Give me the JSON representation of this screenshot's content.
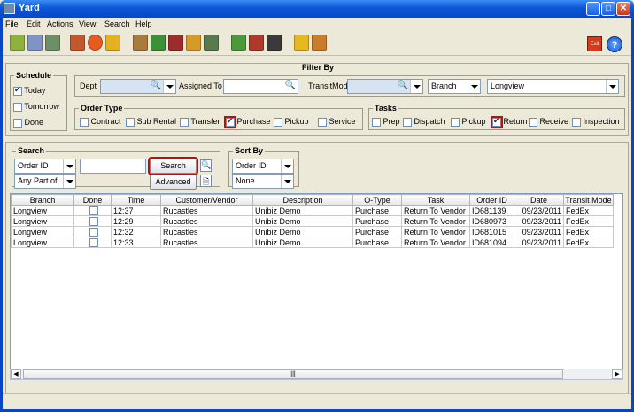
{
  "window": {
    "title": "Yard"
  },
  "menu": [
    "File",
    "Edit",
    "Actions",
    "View",
    "Search",
    "Help"
  ],
  "toolbar": {
    "exit_label": "Exit",
    "help_label": "?"
  },
  "filter": {
    "title": "Filter By"
  },
  "schedule": {
    "title": "Schedule",
    "options": [
      {
        "label": "Today",
        "checked": true
      },
      {
        "label": "Tomorrow",
        "checked": false
      },
      {
        "label": "Done",
        "checked": false
      }
    ]
  },
  "dept": {
    "label": "Dept",
    "value": ""
  },
  "assigned_to": {
    "label": "Assigned To",
    "value": ""
  },
  "transit_mode": {
    "label": "TransitMode",
    "value": ""
  },
  "branch_select": {
    "value": "Branch"
  },
  "location_select": {
    "value": "Longview"
  },
  "order_type": {
    "title": "Order Type",
    "options": [
      {
        "label": "Contract",
        "checked": false
      },
      {
        "label": "Sub Rental",
        "checked": false
      },
      {
        "label": "Transfer",
        "checked": false
      },
      {
        "label": "Purchase",
        "checked": true
      },
      {
        "label": "Pickup",
        "checked": false
      },
      {
        "label": "Service",
        "checked": false
      }
    ]
  },
  "tasks": {
    "title": "Tasks",
    "options": [
      {
        "label": "Prep",
        "checked": false
      },
      {
        "label": "Dispatch",
        "checked": false
      },
      {
        "label": "Pickup",
        "checked": false
      },
      {
        "label": "Return",
        "checked": true
      },
      {
        "label": "Receive",
        "checked": false
      },
      {
        "label": "Inspection",
        "checked": false
      }
    ]
  },
  "search": {
    "title": "Search",
    "field_select": "Order ID",
    "match_select": "Any Part of ...",
    "query": "",
    "search_button": "Search",
    "advanced_button": "Advanced"
  },
  "sort": {
    "title": "Sort By",
    "primary": "Order ID",
    "secondary": "None"
  },
  "table": {
    "columns": [
      "Branch",
      "Done",
      "Time",
      "Customer/Vendor",
      "Description",
      "O-Type",
      "Task",
      "Order ID",
      "Date",
      "Transit Mode"
    ],
    "rows": [
      [
        "Longview",
        "",
        "12:37",
        "Rucastles",
        "Unibiz Demo",
        "Purchase",
        "Return To Vendor",
        "ID681139",
        "09/23/2011",
        "FedEx"
      ],
      [
        "Longview",
        "",
        "12:29",
        "Rucastles",
        "Unibiz Demo",
        "Purchase",
        "Return To Vendor",
        "ID680973",
        "09/23/2011",
        "FedEx"
      ],
      [
        "Longview",
        "",
        "12:32",
        "Rucastles",
        "Unibiz Demo",
        "Purchase",
        "Return To Vendor",
        "ID681015",
        "09/23/2011",
        "FedEx"
      ],
      [
        "Longview",
        "",
        "12:33",
        "Rucastles",
        "Unibiz Demo",
        "Purchase",
        "Return To Vendor",
        "ID681094",
        "09/23/2011",
        "FedEx"
      ]
    ]
  },
  "colors": {
    "title_bar": "#0a56d8",
    "highlight": "#b01515"
  }
}
